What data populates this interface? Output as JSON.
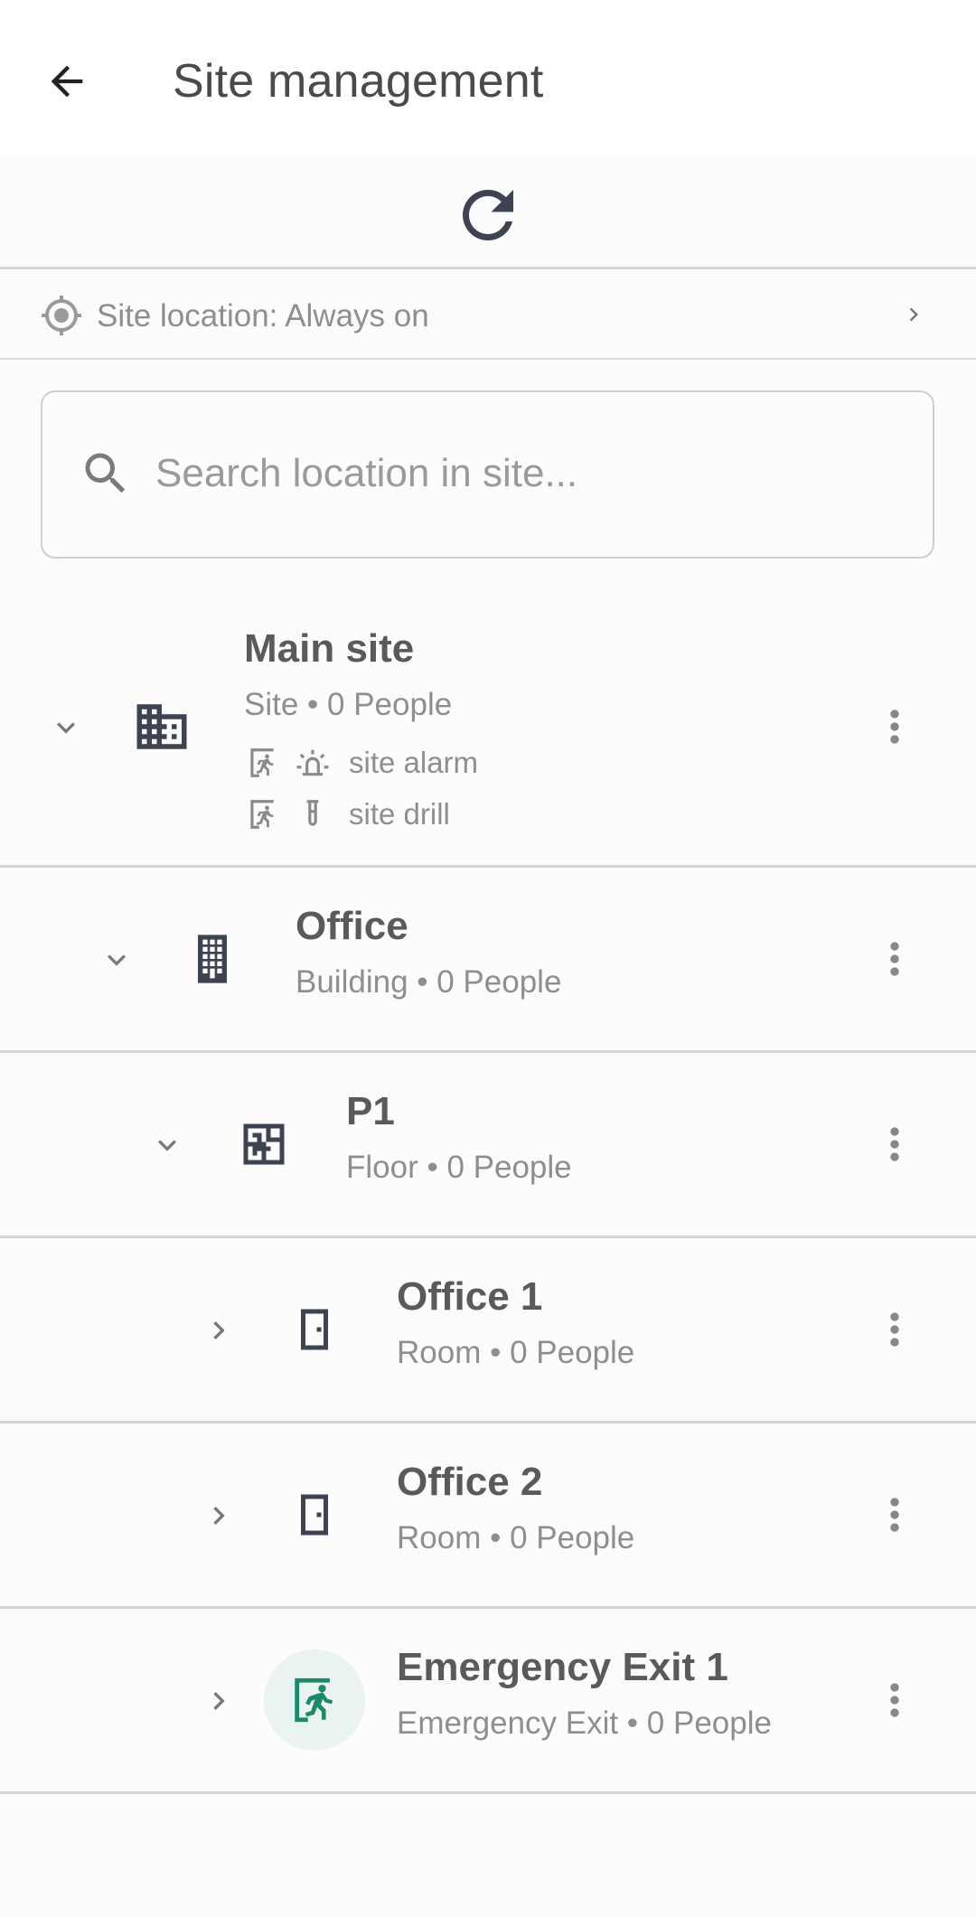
{
  "header": {
    "title": "Site management",
    "back_icon": "arrow-back-icon",
    "refresh_icon": "refresh-icon"
  },
  "site_location": {
    "label": "Site location: Always on",
    "icon": "my-location-icon"
  },
  "search": {
    "placeholder": "Search location in site...",
    "value": ""
  },
  "tree": [
    {
      "name": "Main site",
      "meta": "Site • 0 People",
      "icon": "apartment-icon",
      "expanded": true,
      "tags": [
        {
          "icons": [
            "exit-run-icon",
            "alarm-icon"
          ],
          "label": "site alarm"
        },
        {
          "icons": [
            "exit-run-icon",
            "test-tube-icon"
          ],
          "label": "site drill"
        }
      ]
    },
    {
      "name": "Office",
      "meta": "Building • 0 People",
      "icon": "building-icon",
      "expanded": true
    },
    {
      "name": "P1",
      "meta": "Floor • 0 People",
      "icon": "floor-plan-icon",
      "expanded": true
    },
    {
      "name": "Office 1",
      "meta": "Room • 0 People",
      "icon": "door-icon",
      "expanded": false
    },
    {
      "name": "Office 2",
      "meta": "Room • 0 People",
      "icon": "door-icon",
      "expanded": false
    },
    {
      "name": "Emergency Exit 1",
      "meta": "Emergency Exit • 0 People",
      "icon": "emergency-exit-icon",
      "expanded": false
    }
  ],
  "colors": {
    "icon_dark": "#3d4350",
    "exit_green": "#1b8a6b",
    "exit_bg": "#e9f3ef",
    "divider": "#d4d4d4"
  }
}
